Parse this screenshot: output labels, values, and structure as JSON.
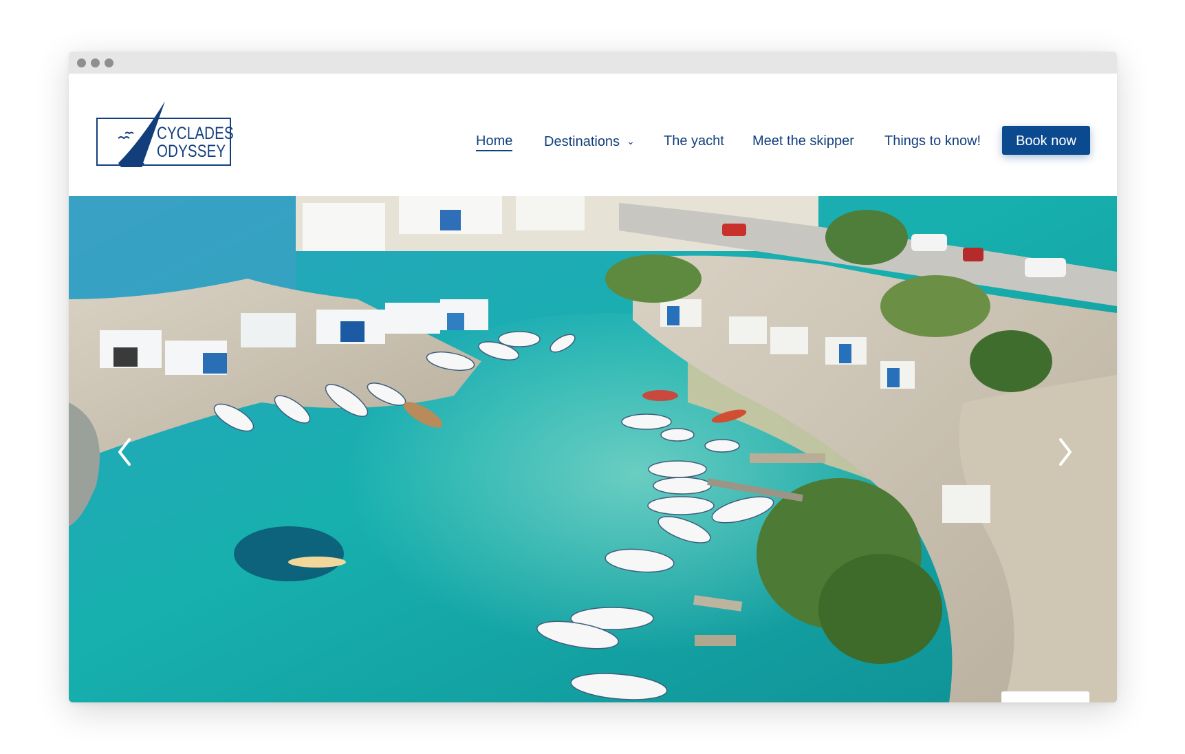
{
  "logo": {
    "line1": "CYCLADES",
    "line2": "ODYSSEY",
    "icon": "sailboat-icon"
  },
  "nav": {
    "items": [
      {
        "label": "Home",
        "active": true
      },
      {
        "label": "Destinations",
        "has_dropdown": true,
        "icon": "chevron-down-icon"
      },
      {
        "label": "The yacht"
      },
      {
        "label": "Meet the skipper"
      },
      {
        "label": "Things to know!"
      }
    ],
    "cta": "Book now",
    "chevron": "⌄"
  },
  "hero": {
    "icons": [
      "chevron-left-icon",
      "chevron-right-icon"
    ]
  },
  "colors": {
    "brand": "#123f7c",
    "button": "#0c4a8f",
    "water": "#1fb3b5",
    "rock": "#c9c2b3"
  }
}
